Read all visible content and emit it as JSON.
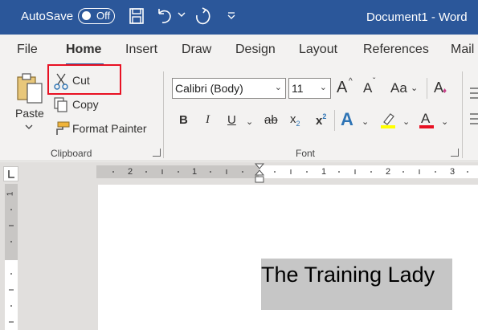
{
  "titlebar": {
    "autosave_label": "AutoSave",
    "autosave_state": "Off",
    "document_title": "Document1  -  Word",
    "icons": [
      "save-icon",
      "undo-icon",
      "redo-icon",
      "customize-quick-access-icon"
    ]
  },
  "tabs": [
    "File",
    "Home",
    "Insert",
    "Draw",
    "Design",
    "Layout",
    "References",
    "Mail"
  ],
  "active_tab": "Home",
  "clipboard": {
    "paste_label": "Paste",
    "cut_label": "Cut",
    "copy_label": "Copy",
    "format_painter_label": "Format Painter",
    "group_label": "Clipboard"
  },
  "font": {
    "font_name": "Calibri (Body)",
    "font_size": "11",
    "grow_font": "A",
    "shrink_font": "A",
    "change_case": "Aa",
    "bold": "B",
    "italic": "I",
    "underline": "U",
    "strikethrough": "ab",
    "subscript": "x",
    "subscript_sub": "2",
    "superscript": "x",
    "superscript_sup": "2",
    "text_effects": "A",
    "font_color": "A",
    "group_label": "Font"
  },
  "ruler": {
    "horizontal_numbers": [
      "2",
      "1",
      "1",
      "2",
      "3"
    ],
    "vertical_numbers": [
      "1"
    ]
  },
  "document": {
    "text": "The Training Lady"
  },
  "colors": {
    "titlebar": "#2b579a",
    "highlight_box": "#e81123",
    "highlighter": "#ffff00",
    "font_color": "#e81123",
    "text_effects": "#2e74b5"
  }
}
